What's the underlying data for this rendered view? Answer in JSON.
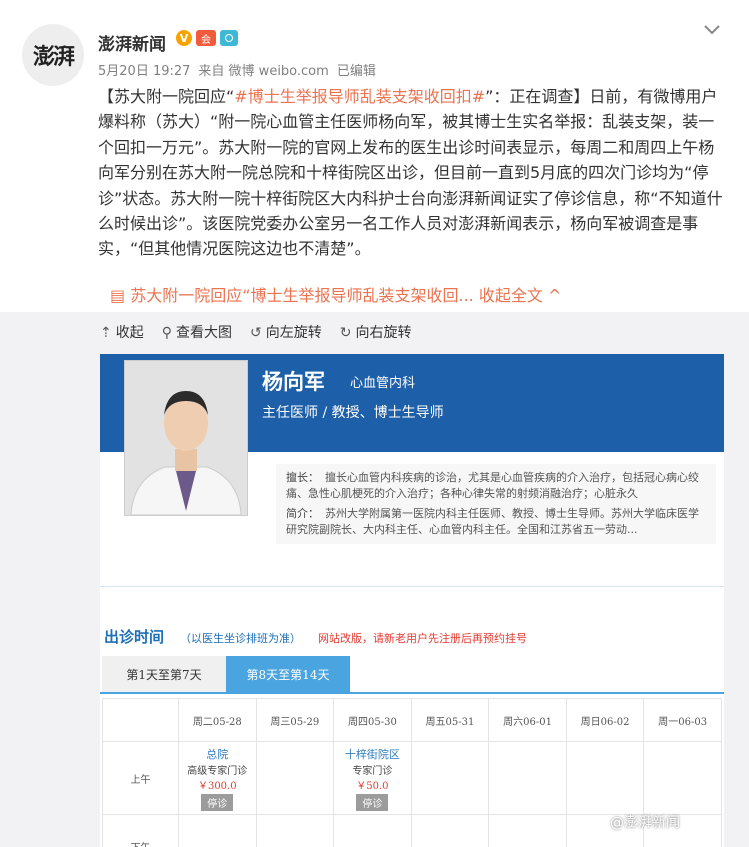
{
  "author": {
    "avatar_text": "澎湃",
    "name": "澎湃新闻",
    "badge_v": "V",
    "badge_g": "会"
  },
  "expand_icon": "chevron-down-icon",
  "meta": {
    "date": "5月20日 19:27",
    "source": "来自 微博 weibo.com",
    "edited": "已编辑"
  },
  "post": {
    "p1": "【苏大附一院回应“",
    "tag": "#博士生举报导师乱装支架收回扣#",
    "p2": "”：正在调查】日前，有微博用户爆料称（苏大）“附一院心血管主任医师杨向军，被其博士生实名举报：乱装支架，装一个回扣一万元”。苏大附一院的官网上发布的医生出诊时间表显示，每周二和周四上午杨向军分别在苏大附一院总院和十梓街院区出诊，但目前一直到5月底的四次门诊均为“停诊”状态。苏大附一院十梓街院区大内科护士台向澎湃新闻证实了停诊信息，称“不知道什么时候出诊”。该医院党委办公室另一名工作人员对澎湃新闻表示，杨向军被调查是事实，“但其他情况医院这边也不清楚”。"
  },
  "collapse": {
    "text": "苏大附一院回应“博士生举报导师乱装支架收回...",
    "link": "收起全文",
    "arrow": "^"
  },
  "toolbar": {
    "collapse": "收起",
    "view": "查看大图",
    "rotate_left": "向左旋转",
    "rotate_right": "向右旋转"
  },
  "doctor": {
    "name": "杨向军",
    "dept": "心血管内科",
    "title": "主任医师 / 教授、博士生导师",
    "skill_label": "擅长：",
    "skill": "擅长心血管内科疾病的诊治，尤其是心血管疾病的介入治疗，包括冠心病心绞痛、急性心肌梗死的介入治疗；各种心律失常的射频消融治疗；心脏永久",
    "intro_label": "简介：",
    "intro": "苏州大学附属第一医院内科主任医师、教授、博士生导师。苏州大学临床医学研究院副院长、大内科主任、心血管内科主任。全国和江苏省五一劳动..."
  },
  "schedule": {
    "title": "出诊时间",
    "subtitle": "（以医生坐诊排班为准）",
    "notice": "网站改版，请新老用户先注册后再预约挂号",
    "tabs": [
      "第1天至第7天",
      "第8天至第14天"
    ],
    "days": [
      "周二05-28",
      "周三05-29",
      "周四05-30",
      "周五05-31",
      "周六06-01",
      "周日06-02",
      "周一06-03"
    ],
    "rows": [
      "上午",
      "下午"
    ],
    "slot1": {
      "location": "总院",
      "kind": "高级专家门诊",
      "price": "￥300.0",
      "status": "停诊"
    },
    "slot2": {
      "location": "十梓街院区",
      "kind": "专家门诊",
      "price": "￥50.0",
      "status": "停诊"
    }
  },
  "watermark": "@澎湃新闻"
}
